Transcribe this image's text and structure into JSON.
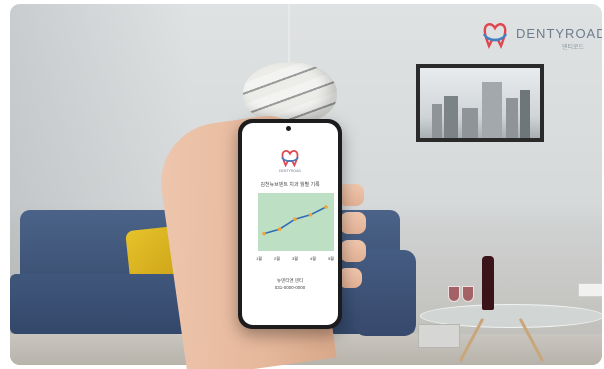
{
  "watermark": {
    "brand": "DENTYROAD",
    "sub": "덴티로드",
    "icon": "tooth-logo-icon"
  },
  "phone": {
    "brand": "DENTYROAD",
    "title": "김천뉴브덴트 치과 월별 기록",
    "months": [
      "1월",
      "2월",
      "3월",
      "4월",
      "5월"
    ],
    "footer_line1": "뉴덴티앤 덴티",
    "footer_line2": "031-0000-0000",
    "chart_colors": {
      "background": "#bde0c4",
      "line": "#2f6db6",
      "point": "#f2a23a"
    }
  },
  "chart_data": {
    "type": "line",
    "categories": [
      "1월",
      "2월",
      "3월",
      "4월",
      "5월"
    ],
    "values": [
      1.2,
      1.6,
      2.5,
      2.9,
      3.6
    ],
    "ylim": [
      0,
      4.5
    ],
    "grid": false
  },
  "colors": {
    "sofa": "#3c5275",
    "pillow": "#d6b21e",
    "wall": "#dcdfe0"
  }
}
